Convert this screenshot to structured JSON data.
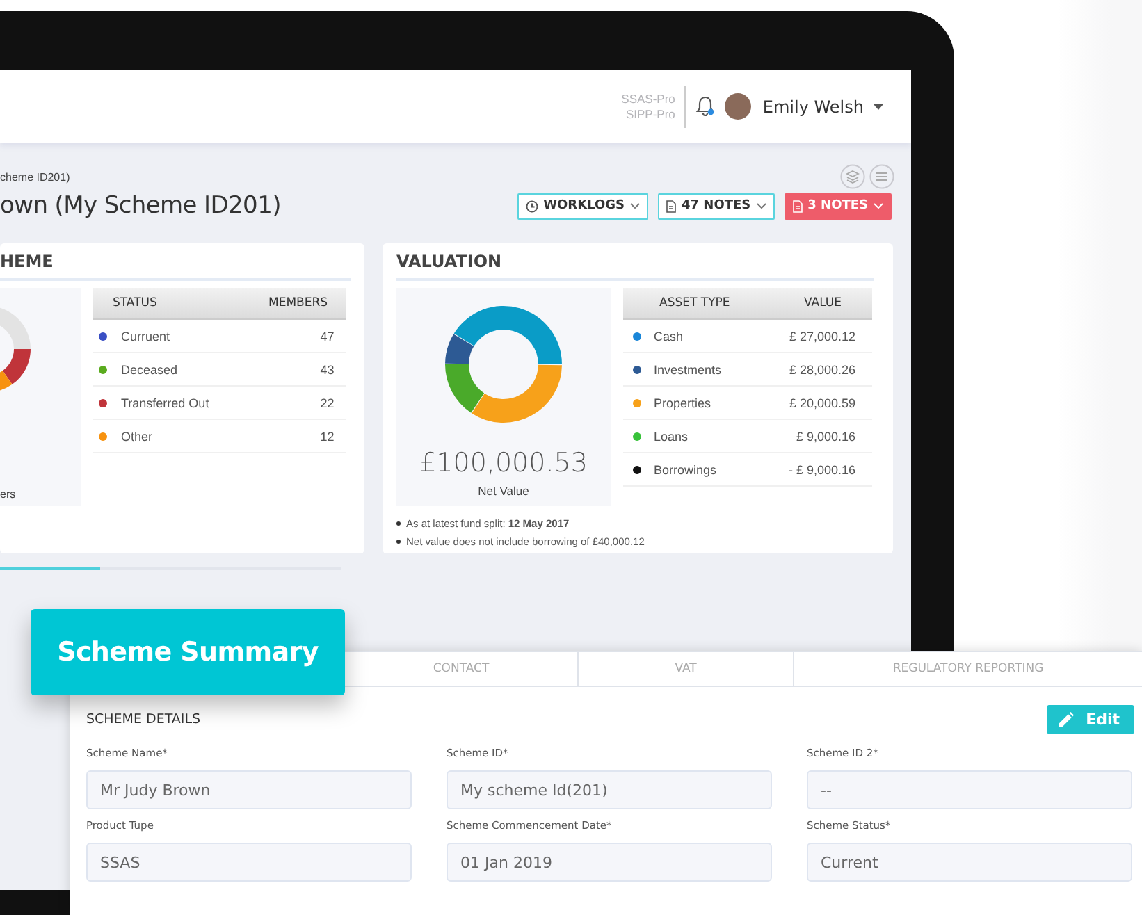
{
  "header": {
    "product_lines": [
      "SSAS-Pro",
      "SIPP-Pro"
    ],
    "user_name": "Emily Welsh"
  },
  "page": {
    "breadcrumb": "cheme ID201)",
    "title": "own (My Scheme ID201)",
    "buttons": [
      {
        "label": "WORKLOGS",
        "kind": "worklogs"
      },
      {
        "label": "47 NOTES",
        "kind": "notes"
      },
      {
        "label": "3 NOTES",
        "kind": "alert"
      }
    ]
  },
  "members_card": {
    "title": "HEME",
    "chart_caption": "ers",
    "columns": [
      "STATUS",
      "MEMBERS"
    ],
    "rows": [
      {
        "status": "Curruent",
        "members": "47",
        "color": "#3a4fc4"
      },
      {
        "status": "Deceased",
        "members": "43",
        "color": "#5aab1e"
      },
      {
        "status": "Transferred Out",
        "members": "22",
        "color": "#c0343a"
      },
      {
        "status": "Other",
        "members": "12",
        "color": "#f7920f"
      }
    ]
  },
  "valuation_card": {
    "title": "VALUATION",
    "net_value": "£100,000.53",
    "net_label": "Net Value",
    "columns": [
      "ASSET TYPE",
      "VALUE"
    ],
    "rows": [
      {
        "asset": "Cash",
        "value": "£ 27,000.12",
        "color": "#1a86d8"
      },
      {
        "asset": "Investments",
        "value": "£ 28,000.26",
        "color": "#2d5a94"
      },
      {
        "asset": "Properties",
        "value": "£ 20,000.59",
        "color": "#f7a11a"
      },
      {
        "asset": "Loans",
        "value": "£ 9,000.16",
        "color": "#38c23a"
      },
      {
        "asset": "Borrowings",
        "value": "- £ 9,000.16",
        "color": "#111111"
      }
    ],
    "notes": [
      "As at latest fund split: **12 May 2017**",
      "Net value does not include borrowing of £40,000.12"
    ]
  },
  "summary": {
    "badge": "Scheme Summary",
    "tabs": [
      {
        "label": "CONTACT",
        "selected": false
      },
      {
        "label": "VAT",
        "selected": false
      },
      {
        "label": "REGULATORY REPORTING",
        "selected": false
      }
    ],
    "section_title": "SCHEME DETAILS",
    "edit_button": "Edit",
    "fields": [
      {
        "label": "Scheme Name*",
        "value": "Mr Judy Brown"
      },
      {
        "label": "Scheme ID*",
        "value": "My scheme Id(201)"
      },
      {
        "label": "Scheme ID 2*",
        "value": "--"
      },
      {
        "label": "Product Tupe",
        "value": "SSAS"
      },
      {
        "label": "Scheme Commencement Date*",
        "value": "01 Jan 2019"
      },
      {
        "label": "Scheme Status*",
        "value": "Current"
      }
    ]
  }
}
